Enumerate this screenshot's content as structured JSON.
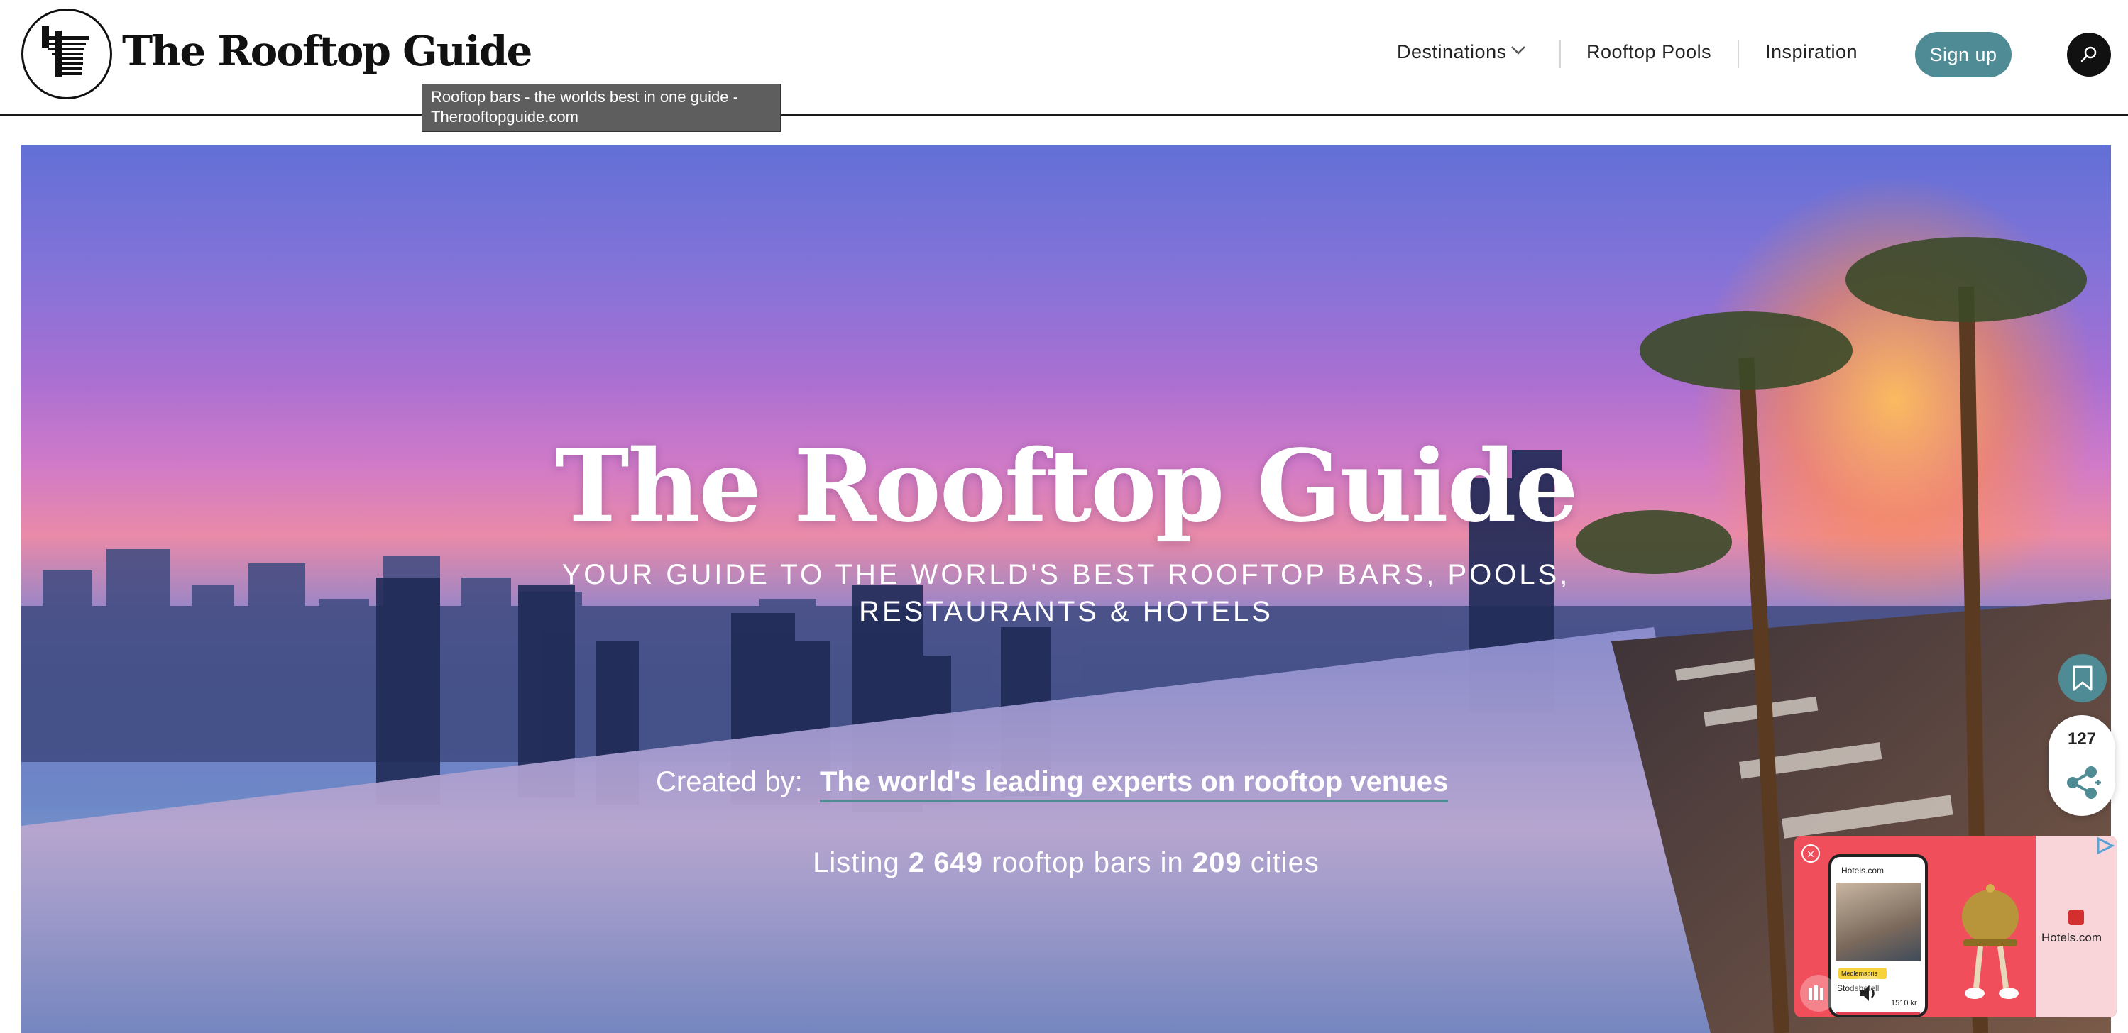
{
  "site": {
    "logo_name": "The Rooftop Guide"
  },
  "nav": {
    "destinations": "Destinations",
    "rooftop_pools": "Rooftop Pools",
    "inspiration": "Inspiration",
    "signup": "Sign up",
    "search_icon": "search-icon",
    "dropdown_icon": "chevron-down-icon"
  },
  "tooltip": {
    "text": "Rooftop bars - the worlds best in one guide - Therooftopguide.com"
  },
  "hero": {
    "title": "The Rooftop Guide",
    "subtitle_line1": "YOUR GUIDE TO THE WORLD'S BEST ROOFTOP BARS, POOLS,",
    "subtitle_line2": "RESTAURANTS & HOTELS",
    "listing_prefix": "Listing",
    "listing_count": "2 649",
    "listing_middle": "rooftop bars in",
    "listing_cities": "209",
    "listing_suffix": "cities",
    "created_label": "Created by:",
    "created_link": "The world's leading experts on rooftop venues"
  },
  "floating": {
    "share_count": "127",
    "bookmark_icon": "bookmark-icon",
    "share_icon": "share-icon"
  },
  "ad": {
    "brand": "Hotels.com",
    "tag": "Medlemspris",
    "hotel": "Stodshotell",
    "price": "1510 kr",
    "side_brand": "Hotels.com"
  },
  "colors": {
    "accent": "#4f8b95",
    "dark": "#111111",
    "ad_red": "#ef4e5a"
  }
}
